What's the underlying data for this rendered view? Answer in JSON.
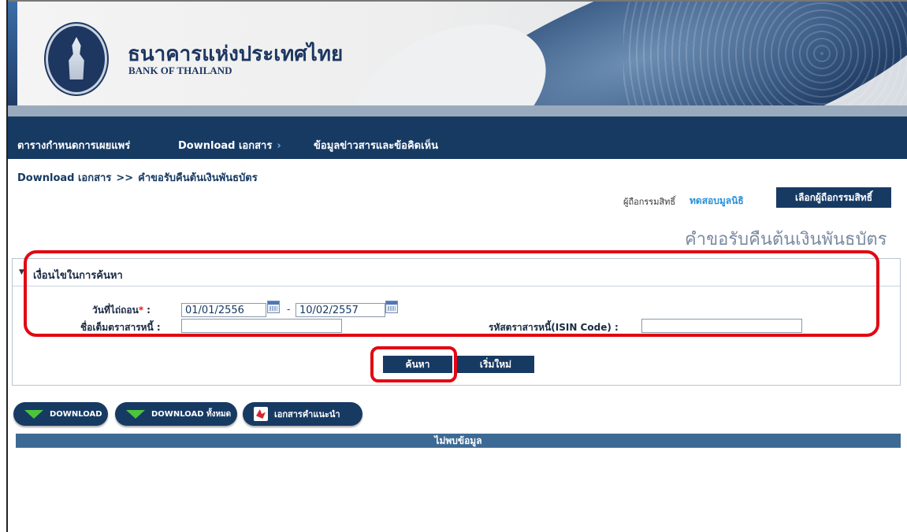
{
  "header": {
    "brand_th": "ธนาคารแห่งประเทศไทย",
    "brand_en": "BANK OF THAILAND",
    "logo_icon": "bank-emblem-icon"
  },
  "nav": {
    "items": [
      {
        "label": "ตารางกำหนดการเผยแพร่"
      },
      {
        "label": "Download เอกสาร",
        "arrow": "›"
      },
      {
        "label": "ข้อมูลข่าวสารและข้อคิดเห็น"
      }
    ]
  },
  "breadcrumb": {
    "root": "Download เอกสาร",
    "sep": ">>",
    "current": "คำขอรับคืนต้นเงินพันธบัตร"
  },
  "holder": {
    "label": "ผู้ถือกรรมสิทธิ์",
    "value": "ทดสอบมูลนิธิ",
    "select_button": "เลือกผู้ถือกรรมสิทธิ์"
  },
  "page_title": "คำขอรับคืนต้นเงินพันธบัตร",
  "search": {
    "panel_title": "เงื่อนไขในการค้นหา",
    "toggle_icon": "▼",
    "due_date_label": "วันที่ไถ่ถอน",
    "required_mark": "*",
    "colon": ":",
    "date_from": "01/01/2556",
    "date_sep": "-",
    "date_to": "10/02/2557",
    "fullname_label": "ชื่อเต็มตราสารหนี้ :",
    "fullname_value": "",
    "isin_label": "รหัสตราสารหนี้(ISIN Code) :",
    "isin_value": "",
    "search_button": "ค้นหา",
    "reset_button": "เริ่มใหม่"
  },
  "actions": {
    "download": "DOWNLOAD",
    "download_all": "DOWNLOAD ทั้งหมด",
    "guide_doc": "เอกสารคำแนะนำ"
  },
  "results": {
    "empty_message": "ไม่พบข้อมูล"
  },
  "colors": {
    "navy": "#173a63",
    "highlight_red": "#e30613",
    "link_blue": "#2a8fd6",
    "download_green": "#4cc43a"
  }
}
